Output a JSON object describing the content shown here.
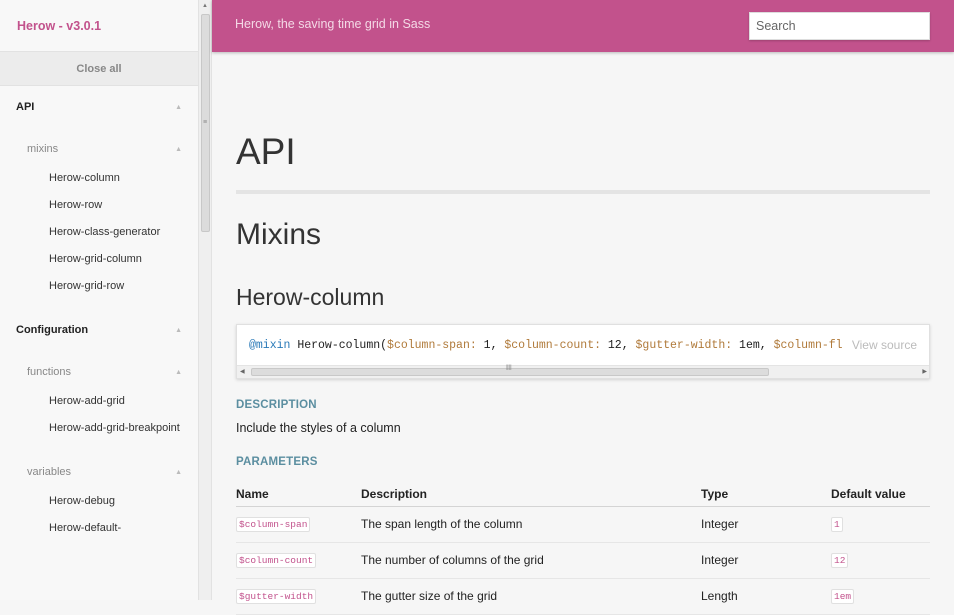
{
  "sidebar": {
    "title": "Herow - v3.0.1",
    "close_all": "Close all",
    "sections": [
      {
        "label": "API",
        "groups": [
          {
            "label": "mixins",
            "items": [
              "Herow-column",
              "Herow-row",
              "Herow-class-generator",
              "Herow-grid-column",
              "Herow-grid-row"
            ]
          }
        ]
      },
      {
        "label": "Configuration",
        "groups": [
          {
            "label": "functions",
            "items": [
              "Herow-add-grid",
              "Herow-add-grid-breakpoint"
            ]
          },
          {
            "label": "variables",
            "items": [
              "Herow-debug",
              "Herow-default-"
            ]
          }
        ]
      }
    ]
  },
  "header": {
    "tagline": "Herow, the saving time grid in Sass",
    "search_placeholder": "Search",
    "background": "#c2528c"
  },
  "main": {
    "page_title": "API",
    "section_title": "Mixins",
    "item_title": "Herow-column",
    "code": {
      "keyword": "@mixin",
      "name": " Herow-column(",
      "parts": [
        {
          "var": "$column-span:",
          "val": " 1, "
        },
        {
          "var": "$column-count:",
          "val": " 12, "
        },
        {
          "var": "$gutter-width:",
          "val": " 1em, "
        },
        {
          "var": "$column-flow:",
          "val": ""
        }
      ],
      "view_source": "View source"
    },
    "description_label": "DESCRIPTION",
    "description": "Include the styles of a column",
    "parameters_label": "PARAMETERS",
    "table": {
      "headers": [
        "Name",
        "Description",
        "Type",
        "Default value"
      ],
      "rows": [
        {
          "name": "$column-span",
          "description": "The span length of the column",
          "type": "Integer",
          "default": "1"
        },
        {
          "name": "$column-count",
          "description": "The number of columns of the grid",
          "type": "Integer",
          "default": "12"
        },
        {
          "name": "$gutter-width",
          "description": "The gutter size of the grid",
          "type": "Length",
          "default": "1em"
        }
      ]
    }
  }
}
